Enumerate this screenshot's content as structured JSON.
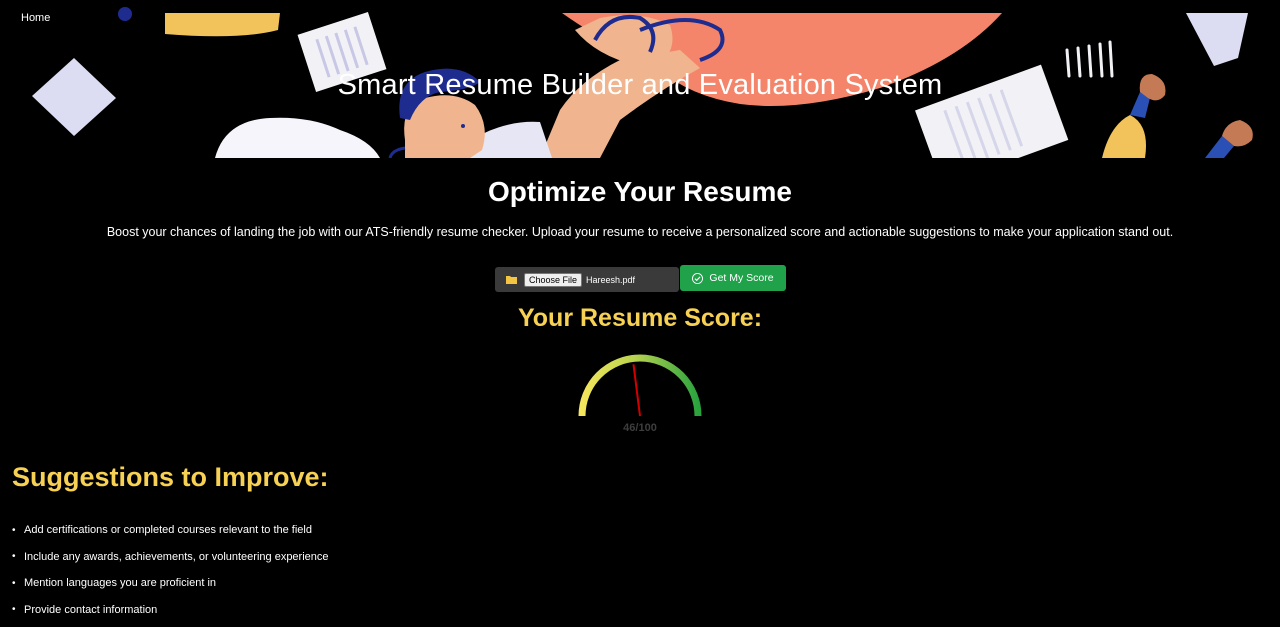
{
  "nav": {
    "home_label": "Home"
  },
  "hero": {
    "title": "Smart Resume Builder and Evaluation System"
  },
  "main": {
    "heading": "Optimize Your Resume",
    "intro": "Boost your chances of landing the job with our ATS-friendly resume checker. Upload your resume to receive a personalized score and actionable suggestions to make your application stand out."
  },
  "upload": {
    "icon": "folder-icon",
    "choose_label": "Choose File",
    "file_name": "Hareesh.pdf",
    "submit_label": "Get My Score",
    "submit_icon": "check-icon"
  },
  "score": {
    "heading": "Your Resume Score:",
    "value": 46,
    "max": 100,
    "display": "46/100"
  },
  "suggestions": {
    "heading": "Suggestions to Improve:",
    "items": [
      "Add certifications or completed courses relevant to the field",
      "Include any awards, achievements, or volunteering experience",
      "Mention languages you are proficient in",
      "Provide contact information"
    ]
  },
  "colors": {
    "accent_yellow": "#f7d154",
    "button_green": "#1fa24a",
    "needle_red": "#d40000"
  }
}
